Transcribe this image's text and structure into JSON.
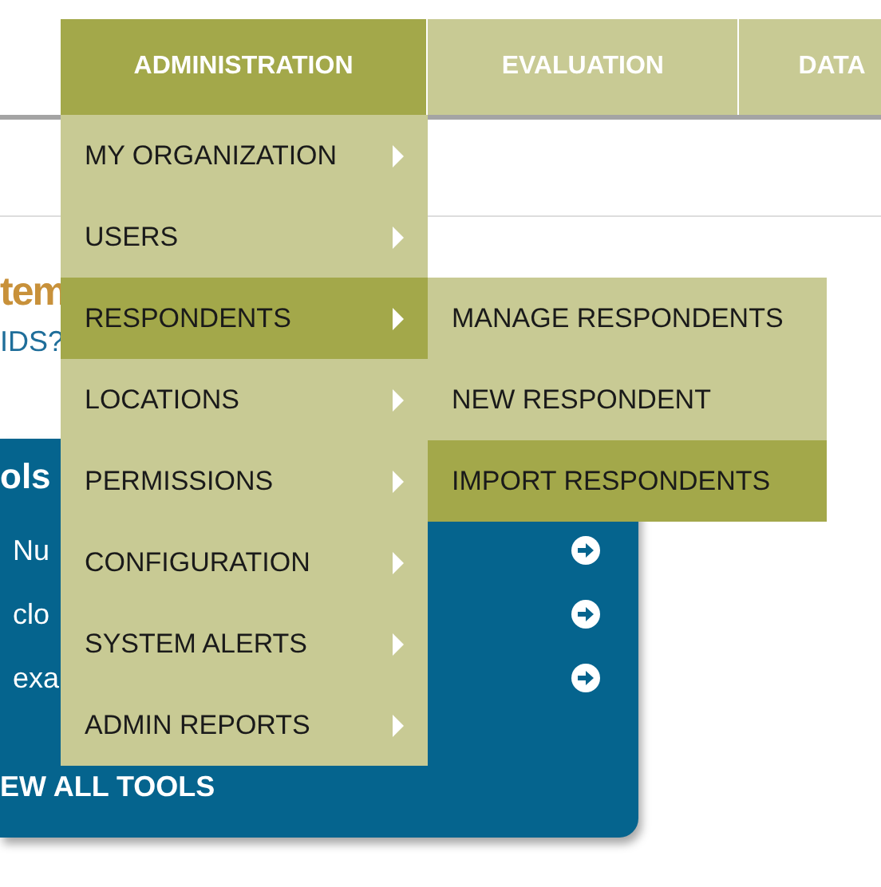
{
  "nav": {
    "tabs": [
      {
        "label": "ADMINISTRATION",
        "selected": true
      },
      {
        "label": "EVALUATION",
        "selected": false
      },
      {
        "label": "DATA",
        "selected": false
      }
    ]
  },
  "page": {
    "heading_parts": [
      "tem"
    ],
    "link": "IDS?",
    "tools_panel": {
      "title": "ols",
      "items": [
        {
          "label": "Nu"
        },
        {
          "label": "clo"
        },
        {
          "label": "exa"
        }
      ],
      "footer": "EW ALL TOOLS"
    }
  },
  "menu": {
    "items": [
      {
        "label": "MY ORGANIZATION",
        "selected": false
      },
      {
        "label": "USERS",
        "selected": false
      },
      {
        "label": "RESPONDENTS",
        "selected": true
      },
      {
        "label": "LOCATIONS",
        "selected": false
      },
      {
        "label": "PERMISSIONS",
        "selected": false
      },
      {
        "label": "CONFIGURATION",
        "selected": false
      },
      {
        "label": "SYSTEM ALERTS",
        "selected": false
      },
      {
        "label": "ADMIN REPORTS",
        "selected": false
      }
    ]
  },
  "submenu": {
    "items": [
      {
        "label": "MANAGE RESPONDENTS",
        "selected": false
      },
      {
        "label": "NEW RESPONDENT",
        "selected": false
      },
      {
        "label": "IMPORT RESPONDENTS",
        "selected": true
      }
    ]
  }
}
